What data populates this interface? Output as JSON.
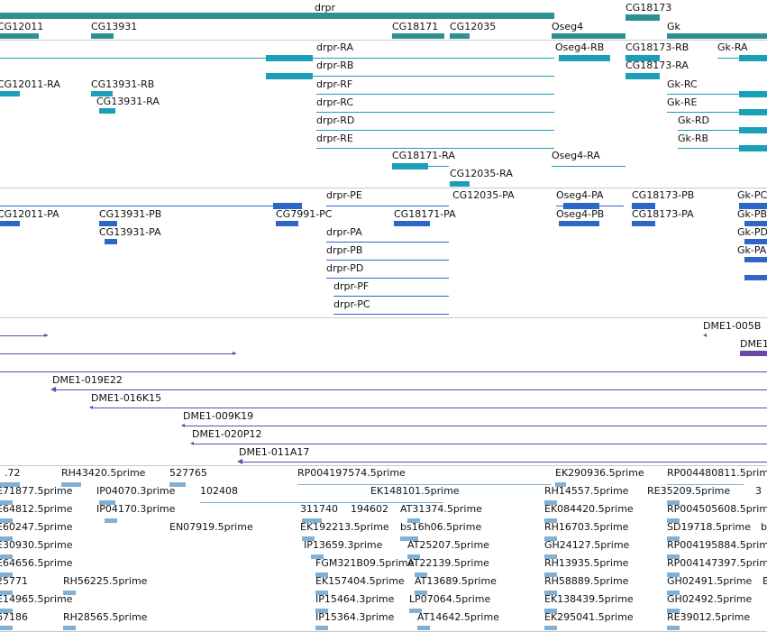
{
  "colors": {
    "gene": "#2f9090",
    "transcript": "#1a9fb8",
    "protein": "#2e66c7",
    "clone": "#6a48a8",
    "est": "#7fb0d6",
    "divider": "#c9c9c9"
  },
  "tracks": {
    "genes": {
      "labels": [
        "CG12011",
        "CG13931",
        "drpr",
        "CG18171",
        "CG12035",
        "Oseg4",
        "CG18173",
        "Gk"
      ]
    },
    "transcripts": {
      "labels": [
        "drpr-RA",
        "Oseg4-RB",
        "CG18173-RB",
        "Gk-RA",
        "CG12011-RA",
        "CG13931-RB",
        "drpr-RB",
        "CG18173-RA",
        "CG13931-RA",
        "drpr-RF",
        "Gk-RC",
        "drpr-RC",
        "Gk-RE",
        "drpr-RD",
        "Gk-RD",
        "drpr-RE",
        "Gk-RB",
        "CG18171-RA",
        "Oseg4-RA",
        "CG12035-RA"
      ]
    },
    "proteins": {
      "labels": [
        "drpr-PE",
        "CG12035-PA",
        "Oseg4-PA",
        "CG18173-PB",
        "Gk-PC",
        "CG12011-PA",
        "CG13931-PB",
        "CG7991-PC",
        "CG18171-PA",
        "Oseg4-PB",
        "CG18173-PA",
        "Gk-PB",
        "CG13931-PA",
        "drpr-PA",
        "Gk-PD",
        "drpr-PB",
        "Gk-PA",
        "drpr-PD",
        "drpr-PF",
        "drpr-PC"
      ]
    },
    "clones": {
      "labels": [
        "DME1-005B",
        "DME1",
        "DME1-019E22",
        "DME1-016K15",
        "DME1-009K19",
        "DME1-020P12",
        "DME1-011A17"
      ]
    },
    "ests": {
      "labels": [
        ".72",
        "RH43420.5prime",
        "527765",
        "RP004197574.5prime",
        "EK290936.5prime",
        "RP004480811.5prime",
        "E71877.5prime",
        "IP04070.3prime",
        "102408",
        "EK148101.5prime",
        "RH14557.5prime",
        "RE35209.5prime",
        "3",
        "E64812.5prime",
        "IP04170.3prime",
        "311740",
        "194602",
        "AT31374.5prime",
        "EK084420.5prime",
        "RP004505608.5prime",
        "E60247.5prime",
        "EN07919.5prime",
        "EK192213.5prime",
        "bs16h06.5prime",
        "RH16703.5prime",
        "SD19718.5prime",
        "b",
        "E30930.5prime",
        "IP13659.3prime",
        "AT25207.5prime",
        "GH24127.5prime",
        "RP004195884.5prime",
        "E64656.5prime",
        "FGM321B09.5prime",
        "AT22139.5prime",
        "RH13935.5prime",
        "RP004147397.5prime",
        "25771",
        "RH56225.5prime",
        "EK157404.5prime",
        "AT13689.5prime",
        "RH58889.5prime",
        "GH02491.5prime",
        "E",
        "E14965.5prime",
        "IP15464.3prime",
        "LP07064.5prime",
        "EK138439.5prime",
        "GH02492.5prime",
        "67186",
        "RH28565.5prime",
        "IP15364.3prime",
        "AT14642.5prime",
        "EK295041.5prime",
        "RE39012.5prime"
      ]
    }
  }
}
